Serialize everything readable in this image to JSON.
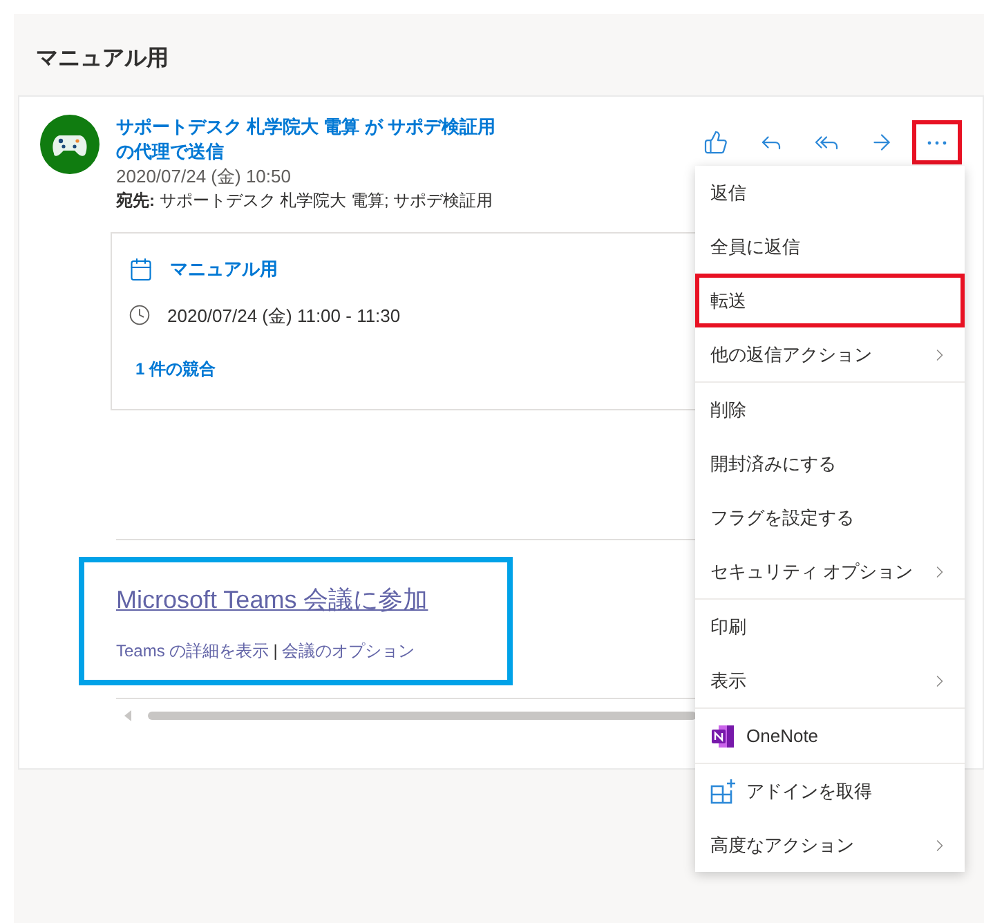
{
  "title": "マニュアル用",
  "message": {
    "sender": "サポートデスク 札学院大  電算 が サポデ検証用の代理で送信",
    "date": "2020/07/24 (金) 10:50",
    "recipients": "**宛先:** サポートデスク 札学院大  電算; サポデ検証用"
  },
  "toolbar": [
    {
      "kind": "like",
      "highlighted": false
    },
    {
      "kind": "reply",
      "highlighted": false
    },
    {
      "kind": "reply_all",
      "highlighted": false
    },
    {
      "kind": "forward",
      "highlighted": false
    },
    {
      "kind": "more",
      "highlighted": true
    }
  ],
  "event": {
    "title": "マニュアル用",
    "time": "2020/07/24 (金) 11:00 - 11:30",
    "conflicts": "1 件の競合"
  },
  "teams": {
    "highlighted": true,
    "join": "Microsoft Teams 会議に参加",
    "details": "Teams の詳細を表示",
    "separator": "|",
    "options": "会議のオプション"
  },
  "menu": [
    [
      {
        "label": "返信",
        "kind": "item",
        "highlighted": false
      },
      {
        "label": "全員に返信",
        "kind": "item",
        "highlighted": false
      },
      {
        "label": "転送",
        "kind": "item",
        "highlighted": true
      },
      {
        "label": "他の返信アクション",
        "kind": "submenu",
        "highlighted": false
      }
    ],
    [
      {
        "label": "削除",
        "kind": "item",
        "highlighted": false
      },
      {
        "label": "開封済みにする",
        "kind": "item",
        "highlighted": false
      },
      {
        "label": "フラグを設定する",
        "kind": "item",
        "highlighted": false
      },
      {
        "label": "セキュリティ オプション",
        "kind": "submenu",
        "highlighted": false
      }
    ],
    [
      {
        "label": "印刷",
        "kind": "item",
        "highlighted": false
      },
      {
        "label": "表示",
        "kind": "submenu",
        "highlighted": false
      }
    ],
    [
      {
        "label": "OneNote",
        "kind": "onenote",
        "highlighted": false
      }
    ],
    [
      {
        "label": "アドインを取得",
        "kind": "addin",
        "highlighted": false
      },
      {
        "label": "高度なアクション",
        "kind": "submenu",
        "highlighted": false
      }
    ]
  ]
}
